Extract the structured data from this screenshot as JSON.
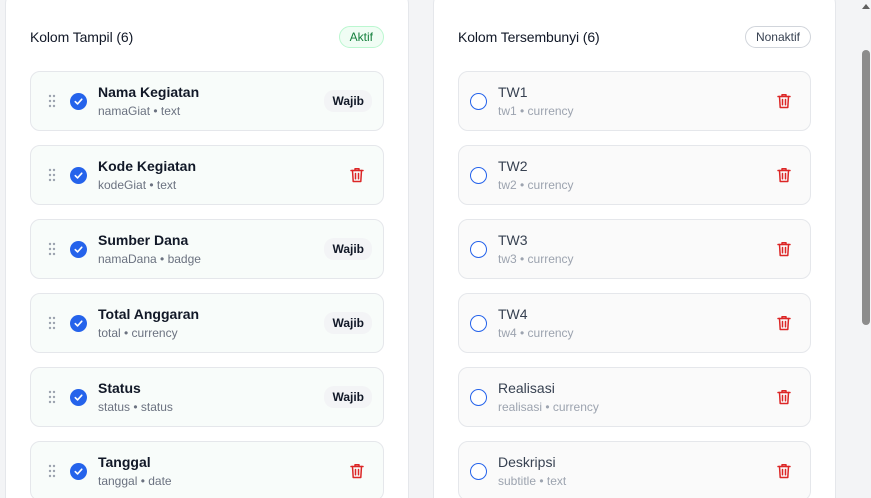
{
  "visible_panel": {
    "title": "Kolom Tampil (6)",
    "status": "Aktif",
    "items": [
      {
        "name": "Nama Kegiatan",
        "meta": "namaGiat • text",
        "action": "Wajib"
      },
      {
        "name": "Kode Kegiatan",
        "meta": "kodeGiat • text",
        "action": "trash"
      },
      {
        "name": "Sumber Dana",
        "meta": "namaDana • badge",
        "action": "Wajib"
      },
      {
        "name": "Total Anggaran",
        "meta": "total • currency",
        "action": "Wajib"
      },
      {
        "name": "Status",
        "meta": "status • status",
        "action": "Wajib"
      },
      {
        "name": "Tanggal",
        "meta": "tanggal • date",
        "action": "trash"
      }
    ]
  },
  "hidden_panel": {
    "title": "Kolom Tersembunyi (6)",
    "status": "Nonaktif",
    "items": [
      {
        "name": "TW1",
        "meta": "tw1 • currency"
      },
      {
        "name": "TW2",
        "meta": "tw2 • currency"
      },
      {
        "name": "TW3",
        "meta": "tw3 • currency"
      },
      {
        "name": "TW4",
        "meta": "tw4 • currency"
      },
      {
        "name": "Realisasi",
        "meta": "realisasi • currency"
      },
      {
        "name": "Deskripsi",
        "meta": "subtitle • text"
      }
    ]
  },
  "icons": {
    "drag": "drag-handle-icon",
    "checked": "checkbox-checked-icon",
    "unchecked": "checkbox-unchecked-icon",
    "delete": "trash-icon"
  },
  "colors": {
    "accent": "#2563eb",
    "active": "#15803d",
    "danger": "#dc2626"
  }
}
